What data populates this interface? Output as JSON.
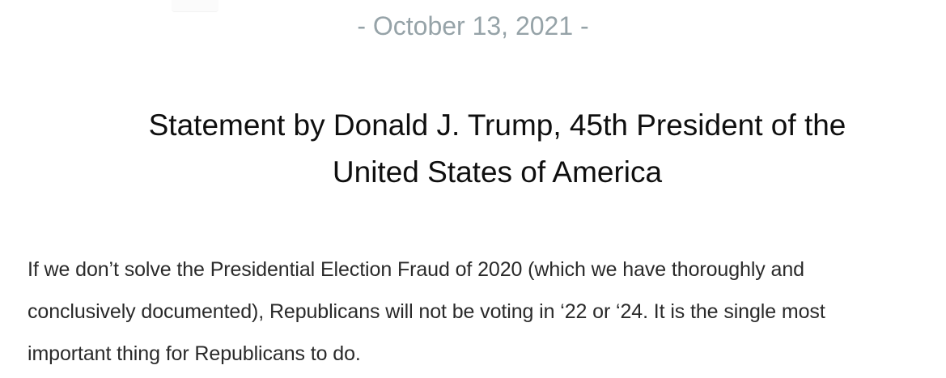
{
  "page": {
    "date_text": "- October 13, 2021 -",
    "title_lines": [
      "Statement by Donald J. Trump, 45th President of the",
      "United States of America"
    ],
    "body_lines": [
      "If we don’t solve the Presidential Election Fraud of 2020 (which we have thoroughly and",
      "conclusively documented), Republicans will not be voting in ‘22 or ‘24. It is the single most",
      "important thing for Republicans to do."
    ]
  }
}
